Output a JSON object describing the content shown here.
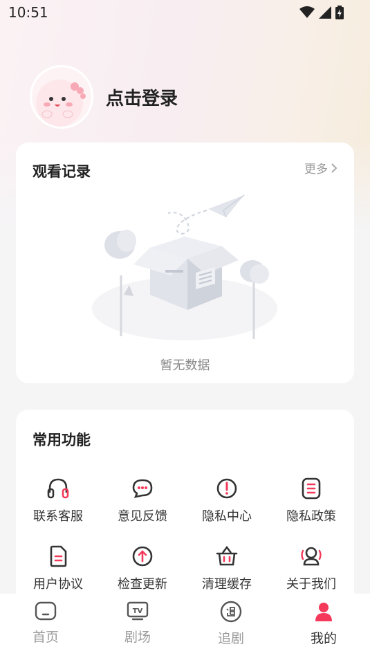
{
  "status_bar": {
    "time": "10:51"
  },
  "profile": {
    "login_text": "点击登录"
  },
  "history": {
    "title": "观看记录",
    "more_label": "更多",
    "empty_text": "暂无数据"
  },
  "functions": {
    "title": "常用功能",
    "items": [
      {
        "label": "联系客服",
        "icon": "headset-icon"
      },
      {
        "label": "意见反馈",
        "icon": "chat-bubble-icon"
      },
      {
        "label": "隐私中心",
        "icon": "exclamation-circle-icon"
      },
      {
        "label": "隐私政策",
        "icon": "document-list-icon"
      },
      {
        "label": "用户协议",
        "icon": "file-icon"
      },
      {
        "label": "检查更新",
        "icon": "arrow-up-circle-icon"
      },
      {
        "label": "清理缓存",
        "icon": "basket-icon"
      },
      {
        "label": "关于我们",
        "icon": "people-icon"
      }
    ]
  },
  "bottom_nav": {
    "tabs": [
      {
        "label": "首页",
        "icon": "home-icon"
      },
      {
        "label": "剧场",
        "icon": "tv-icon"
      },
      {
        "label": "追剧",
        "icon": "follow-icon"
      },
      {
        "label": "我的",
        "icon": "user-icon"
      }
    ],
    "active": "我的"
  },
  "colors": {
    "accent": "#f4395a",
    "icon_dark": "#333333"
  }
}
